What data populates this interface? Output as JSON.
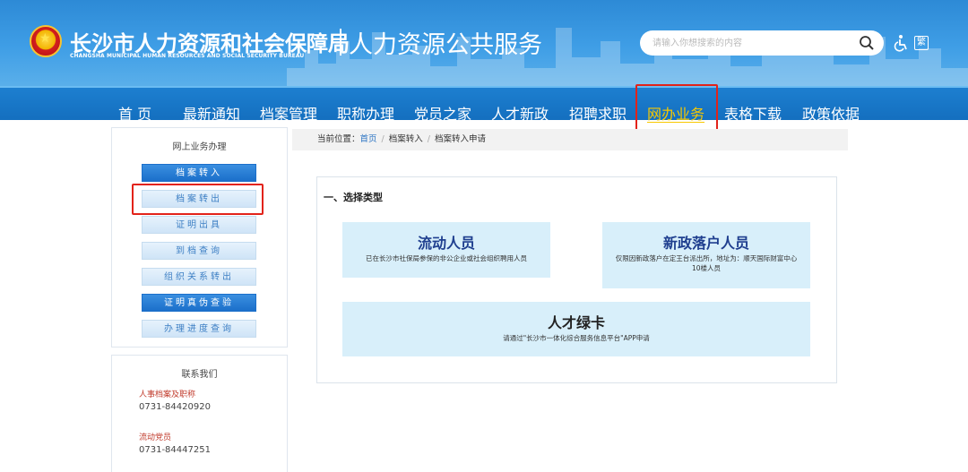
{
  "header": {
    "title_cn": "长沙市人力资源和社会保障局",
    "title_en": "CHANGSHA MUNICIPAL HUMAN RESOURCES AND SOCIAL SECURITY BUREAU",
    "subtitle": "人力资源公共服务",
    "search_placeholder": "请输入你想搜索的内容",
    "trad_label": "繁",
    "icons": [
      "emblem-icon",
      "search-icon",
      "accessibility-icon",
      "traditional-chinese-icon"
    ]
  },
  "nav": {
    "items": [
      {
        "label": "首 页"
      },
      {
        "label": "最新通知"
      },
      {
        "label": "档案管理"
      },
      {
        "label": "职称办理"
      },
      {
        "label": "党员之家"
      },
      {
        "label": "人才新政"
      },
      {
        "label": "招聘求职"
      },
      {
        "label": "网办业务",
        "active": true
      },
      {
        "label": "表格下载"
      },
      {
        "label": "政策依据"
      }
    ],
    "active_color": "#f7c800"
  },
  "sidebar": {
    "title": "网上业务办理",
    "items": [
      {
        "label": "档案转入",
        "style": "dark"
      },
      {
        "label": "档案转出",
        "style": "light"
      },
      {
        "label": "证明出具",
        "style": "light"
      },
      {
        "label": "到档查询",
        "style": "light"
      },
      {
        "label": "组织关系转出",
        "style": "light"
      },
      {
        "label": "证明真伪查验",
        "style": "dark"
      },
      {
        "label": "办理进度查询",
        "style": "light"
      }
    ]
  },
  "contact": {
    "title": "联系我们",
    "entries": [
      {
        "label": "人事档案及职称",
        "phone": "0731-84420920"
      },
      {
        "label": "流动党员",
        "phone": "0731-84447251"
      }
    ]
  },
  "breadcrumb": {
    "prefix": "当前位置：",
    "items": [
      "首页",
      "档案转入",
      "档案转入申请"
    ]
  },
  "main": {
    "section_title": "一、选择类型",
    "cards": [
      {
        "title": "流动人员",
        "desc": "已在长沙市社保局参保的非公企业或社会组织聘用人员"
      },
      {
        "title": "新政落户人员",
        "desc": "仅限因新政落户在定王台派出所，地址为：顺天国际财富中心10楼人员"
      },
      {
        "title": "人才绿卡",
        "desc": "请通过\"长沙市一体化综合服务信息平台\"APP申请"
      }
    ]
  },
  "colors": {
    "header_blue": "#3f9ee6",
    "nav_blue": "#146fbf",
    "highlight_red": "#e2231a",
    "card_bg": "#d8effa"
  }
}
